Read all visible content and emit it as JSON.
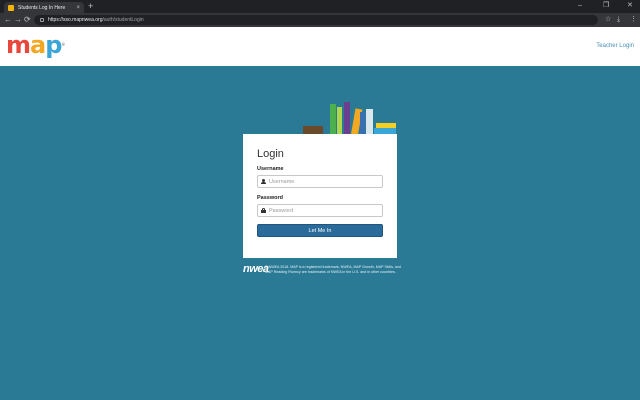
{
  "browser": {
    "tab_title": "Students Log In Here",
    "tab_close": "×",
    "new_tab": "+",
    "minimize": "–",
    "restore": "❐",
    "close": "✕",
    "back": "←",
    "forward": "→",
    "reload": "⟳",
    "url_host": "https://sso.mapnwea.org",
    "url_path": "/auth/studentLogin",
    "star": "☆",
    "download": "⤓",
    "menu": "⋮"
  },
  "header": {
    "logo_letters": [
      {
        "char": "m",
        "color": "#e8473b"
      },
      {
        "char": "a",
        "color": "#f2a823"
      },
      {
        "char": "p",
        "color": "#3aa6d8"
      }
    ],
    "logo_tm": "®",
    "teacher_login": "Teacher Login"
  },
  "books": [
    {
      "color": "#6b4a2b"
    },
    {
      "color": "#4caf50"
    },
    {
      "color": "#b0d64a"
    },
    {
      "color": "#6b3f8f"
    },
    {
      "color": "#f2a823"
    },
    {
      "color": "#3a6fb5"
    },
    {
      "color": "#d9e8ec"
    },
    {
      "color": "#3aa6d8"
    },
    {
      "color": "#f2d023"
    }
  ],
  "login": {
    "title": "Login",
    "username_label": "Username",
    "username_placeholder": "Username",
    "password_label": "Password",
    "password_placeholder": "Password",
    "submit_label": "Let Me In"
  },
  "footer": {
    "nwea_logo": "nwea",
    "copyright": "© NWEA 2018. MAP is a registered trademark, NWEA, MAP Growth, MAP Skills, and MAP Reading Fluency are trademarks of NWEA in the U.S. and in other countries."
  },
  "colors": {
    "page_background": "#2a7a96",
    "button": "#2a6b9a",
    "link": "#4a90b8"
  }
}
